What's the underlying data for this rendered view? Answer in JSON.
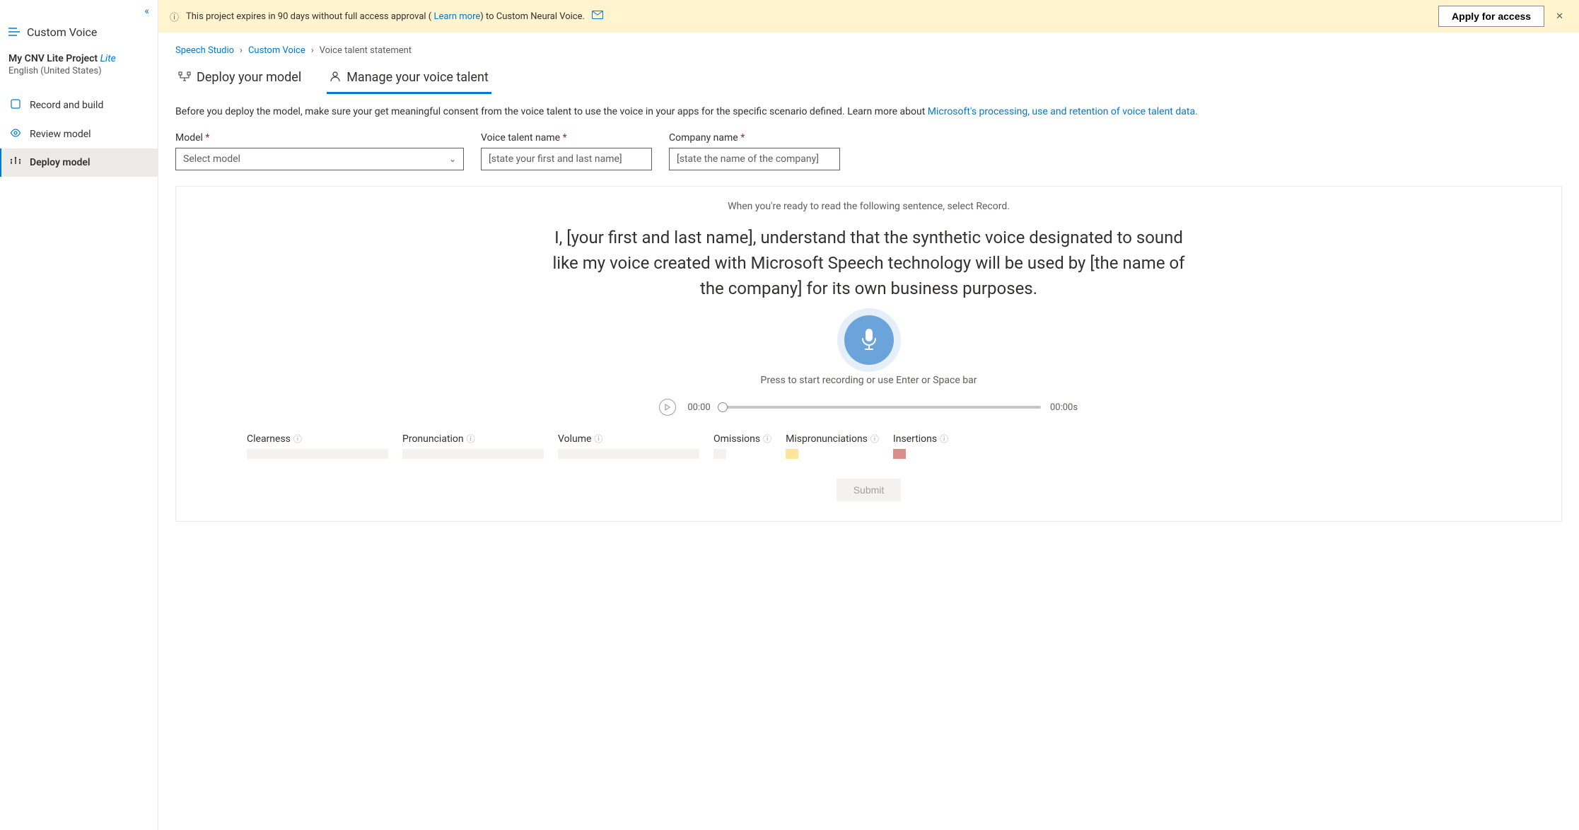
{
  "sidebar": {
    "app_label": "Custom Voice",
    "project_name": "My CNV Lite Project",
    "project_tag": "Lite",
    "locale": "English (United States)",
    "items": [
      {
        "label": "Record and build"
      },
      {
        "label": "Review model"
      },
      {
        "label": "Deploy model"
      }
    ]
  },
  "banner": {
    "text_prefix": "This project expires in 90 days without full access approval ( ",
    "link": "Learn more",
    "text_suffix": ") to Custom Neural Voice.",
    "apply": "Apply for access"
  },
  "breadcrumbs": {
    "a": "Speech Studio",
    "b": "Custom Voice",
    "current": "Voice talent statement"
  },
  "tabs": {
    "deploy": "Deploy your model",
    "manage": "Manage your voice talent"
  },
  "desc": {
    "before": "Before you deploy the model, make sure your get meaningful consent from the voice talent to use the voice in your apps for the specific scenario defined. Learn more about ",
    "link": "Microsoft's processing, use and retention of voice talent data."
  },
  "fields": {
    "model": {
      "label": "Model",
      "placeholder": "Select model"
    },
    "talent": {
      "label": "Voice talent name",
      "placeholder": "[state your first and last name]"
    },
    "company": {
      "label": "Company name",
      "placeholder": "[state the name of the company]"
    }
  },
  "statement": {
    "ready": "When you're ready to read the following sentence, select Record.",
    "text": "I, [your first and last name], understand that the synthetic voice designated to sound like my voice created with Microsoft Speech technology will be used by [the name of the company] for its own business purposes.",
    "hint": "Press to start recording or use Enter or Space bar",
    "time_start": "00:00",
    "time_total": "00:00s"
  },
  "metrics": {
    "clearness": "Clearness",
    "pronunciation": "Pronunciation",
    "volume": "Volume",
    "omissions": "Omissions",
    "mispron": "Mispronunciations",
    "insertions": "Insertions"
  },
  "submit": "Submit"
}
